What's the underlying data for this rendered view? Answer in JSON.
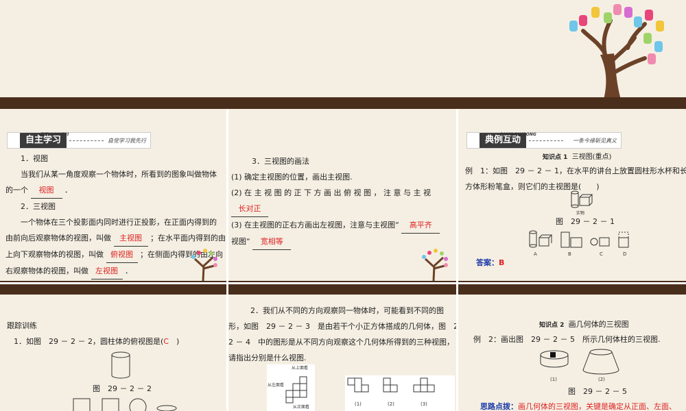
{
  "panel1": {
    "header_pinyin": "ZIZHUXUEXI",
    "header_title": "自主学习",
    "header_motto": "自觉学习我先行",
    "item1_title": "1．视图",
    "item1_text_a": "当我们从某一角度观察一个物体时，所看到的图象叫做物体",
    "item1_text_b": "的一个",
    "item1_blank": "视图",
    "item1_text_c": "．",
    "item2_title": "2．三视图",
    "item2_l1": "一个物体在三个投影面内同时进行正投影，在正面内得到的",
    "item2_l2a": "由前向后观察物体的视图，叫做",
    "item2_blank1": "主视图",
    "item2_l2b": "；在水平面内得到的由",
    "item2_l3a": "上向下观察物体的视图，叫做",
    "item2_blank2": "俯视图",
    "item2_l3b": "；在侧面内得到的由左向",
    "item2_l4a": "右观察物体的视图，叫做",
    "item2_blank3": "左视图",
    "item2_l4b": "．"
  },
  "panel2": {
    "title": "3．三视图的画法",
    "l1": "(1) 确定主视图的位置，画出主视图.",
    "l2": "(2) 在 主 视 图 的 正 下 方 画 出 俯 视 图 ， 注 意 与 主 视",
    "blank1": "长对正",
    "l3a": "(3) 在主视图的正右方画出左视图，注意与主视图“",
    "blank2": "高平齐",
    "l4a": "视图“",
    "blank3": "宽相等"
  },
  "panel3": {
    "header_pinyin": "DIANLIHUDONG",
    "header_title": "典例互动",
    "header_motto": "一条今缘斩见真义",
    "kp_label": "知识点 1",
    "kp_title": "三视图(重点)",
    "ex_l1": "例　1：如图　29 － 2 － 1，在水平的讲台上放置圆柱形水杯和长",
    "ex_l2": "方体形粉笔盒，则它们的主视图是(　　)",
    "real_label": "实物",
    "fig_caption": "图　29 － 2 － 1",
    "options": [
      "A",
      "B",
      "C",
      "D"
    ],
    "answer_label": "答案：",
    "answer": "B"
  },
  "panel4": {
    "title": "跟踪训练",
    "q1": "1．如图　29 － 2 － 2，圆柱体的俯视图是(",
    "q1_answer": "C",
    "q1_end": "　)",
    "fig_caption": "图　29 － 2 － 2"
  },
  "panel5": {
    "l1": "2．我们从不同的方向观察同一物体时，可能看到不同的图",
    "l2": "形，如图　29 － 2 － 3　是由若干个小正方体搭成的几何体，图　29 －",
    "l3": "2 － 4　中的图形是从不同方向观察这个几何体所得到的三种视图，",
    "l4": "请指出分别是什么视图.",
    "label_top": "从上面看",
    "label_left": "从左面看",
    "label_front": "从正面看",
    "sub1": "(1)",
    "sub2": "(2)",
    "sub3": "(3)"
  },
  "panel6": {
    "kp_label": "知识点 2",
    "kp_title": "画几何体的三视图",
    "ex_l1": "例　2：画出图　29 － 2 － 5　所示几何体柱的三视图.",
    "sub1": "(1)",
    "sub2": "(2)",
    "fig_caption": "图　29 － 2 － 5",
    "hint_label": "思路点拨：",
    "hint_text": "画几何体的三视图，关键是确定从正面、左面、"
  },
  "colors": {
    "brown": "#4a2e1c",
    "red": "#dd2222",
    "blue": "#1a3aa8",
    "background": "#f5efe3"
  }
}
